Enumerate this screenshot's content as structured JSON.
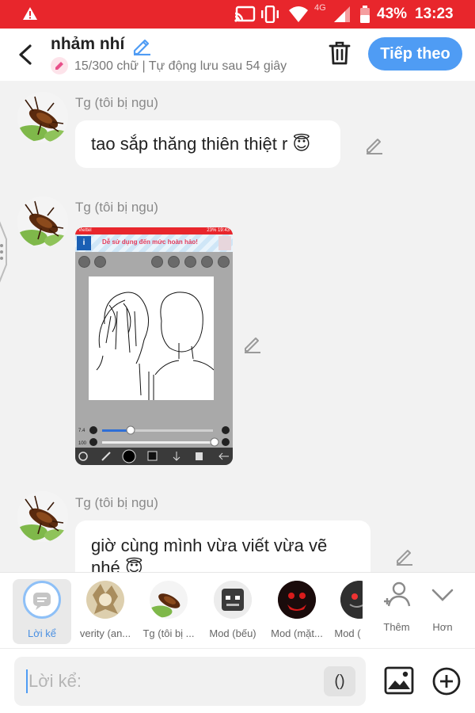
{
  "status_bar": {
    "network": "4G",
    "battery": "43%",
    "time": "13:23"
  },
  "header": {
    "title": "nhảm nhí",
    "subtitle": "15/300 chữ | Tự động lưu sau 54 giây",
    "next_label": "Tiếp theo"
  },
  "messages": [
    {
      "sender": "Tg (tôi bị ngu)",
      "text": "tao sắp thăng thiên thiệt r 😇"
    },
    {
      "sender": "Tg (tôi bị ngu)"
    },
    {
      "sender": "Tg (tôi bị ngu)",
      "text": "giờ cùng mình vừa viết vừa vẽ nhé 😇"
    }
  ],
  "embedded_screenshot": {
    "carrier": "Viettel",
    "status": "23% 19:43",
    "slogan": "Dễ sử dụng đến mức hoàn hảo!",
    "slider_size": "7.4",
    "slider_opacity": "100"
  },
  "participants": [
    {
      "label": "Lời kể"
    },
    {
      "label": "verity (an..."
    },
    {
      "label": "Tg (tôi bị ..."
    },
    {
      "label": "Mod (bếu)"
    },
    {
      "label": "Mod (mặt..."
    },
    {
      "label": "Mod ("
    }
  ],
  "actions": {
    "more_label": "Thêm",
    "expand_label": "Hơn"
  },
  "composer": {
    "placeholder": "Lời kể:",
    "paren_label": "()"
  },
  "colors": {
    "status_red": "#e8262c",
    "accent_blue": "#4f9cf4"
  }
}
